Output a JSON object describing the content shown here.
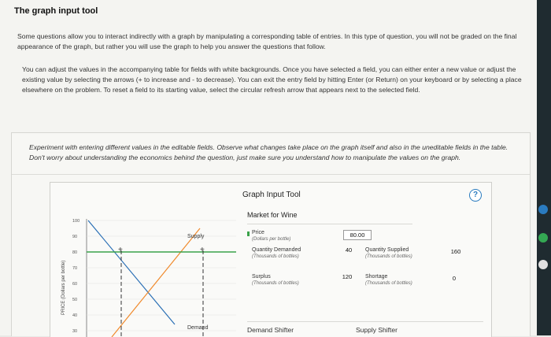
{
  "title": "The graph input tool",
  "paragraph1": "Some questions allow you to interact indirectly with a graph by manipulating a corresponding table of entries. In this type of question, you will not be graded on the final appearance of the graph, but rather you will use the graph to help you answer the questions that follow.",
  "paragraph2": "You can adjust the values in the accompanying table for fields with white backgrounds. Once you have selected a field, you can either enter a new value or adjust the existing value by selecting the arrows (+ to increase and - to decrease). You can exit the entry field by hitting Enter (or Return) on your keyboard or by selecting a place elsewhere on the problem. To reset a field to its starting value, select the circular refresh arrow that appears next to the selected field.",
  "paragraph3": "Experiment with entering different values in the editable fields. Observe what changes take place on the graph itself and also in the uneditable fields in the table. Don't worry about understanding the economics behind the question, just make sure you understand how to manipulate the values on the graph.",
  "tool": {
    "title": "Graph Input Tool",
    "help": "?",
    "market_title": "Market for Wine",
    "price_label": "Price",
    "price_unit": "(Dollars per bottle)",
    "price_value": "80.00",
    "qd_label": "Quantity Demanded",
    "qd_unit": "(Thousands of bottles)",
    "qd_value": "40",
    "qs_label": "Quantity Supplied",
    "qs_unit": "(Thousands of bottles)",
    "qs_value": "160",
    "surplus_label": "Surplus",
    "surplus_unit": "(Thousands of bottles)",
    "surplus_value": "120",
    "shortage_label": "Shortage",
    "shortage_unit": "(Thousands of bottles)",
    "shortage_value": "0",
    "demand_shifter": "Demand Shifter",
    "supply_shifter": "Supply Shifter"
  },
  "chart_data": {
    "type": "line",
    "ylabel": "PRICE (Dollars per bottle)",
    "yticks": [
      100,
      90,
      80,
      70,
      60,
      50,
      40,
      30
    ],
    "ylim": [
      30,
      100
    ],
    "series": [
      {
        "name": "Supply",
        "color": "#f08a2c"
      },
      {
        "name": "Demand",
        "color": "#2a6fb5"
      }
    ],
    "price_line": 80,
    "price_line_color": "#3aa24a"
  },
  "colors": {
    "accent": "#2a7bbf",
    "supply": "#f08a2c",
    "demand": "#2a6fb5",
    "price_line": "#3aa24a"
  }
}
